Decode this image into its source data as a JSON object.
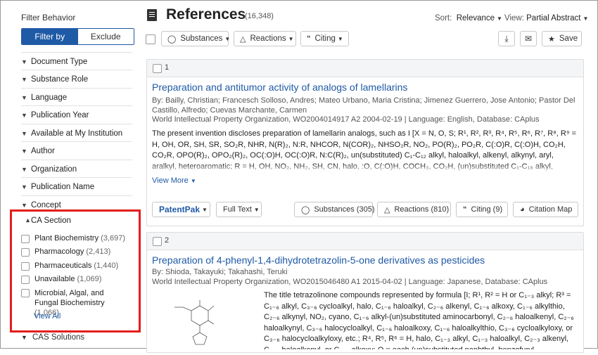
{
  "sidebar": {
    "title": "Filter Behavior",
    "filter_by": "Filter by",
    "exclude": "Exclude",
    "facets": [
      "Document Type",
      "Substance Role",
      "Language",
      "Publication Year",
      "Available at My Institution",
      "Author",
      "Organization",
      "Publication Name",
      "Concept"
    ],
    "cas_section": {
      "label": "CA Section",
      "options": [
        {
          "name": "Plant Biochemistry",
          "count": "(3,697)"
        },
        {
          "name": "Pharmacology",
          "count": "(2,413)"
        },
        {
          "name": "Pharmaceuticals",
          "count": "(1,440)"
        },
        {
          "name": "Unavailable",
          "count": "(1,069)"
        },
        {
          "name": "Microbial, Algal, and Fungal Biochemistry",
          "count": "(1,066)"
        }
      ],
      "view_all": "View All"
    },
    "cas_solutions": "CAS Solutions"
  },
  "header": {
    "title": "References",
    "count": "(16,348)",
    "sort_label": "Sort:",
    "sort_value": "Relevance",
    "view_label": "View:",
    "view_value": "Partial Abstract"
  },
  "toolbar": {
    "substances": "Substances",
    "reactions": "Reactions",
    "citing": "Citing",
    "save": "Save"
  },
  "results": [
    {
      "num": "1",
      "title": "Preparation and antitumor activity of analogs of lamellarins",
      "authors": "By: Bailly, Christian; Francesch Solloso, Andres; Mateo Urbano, Maria Cristina; Jimenez Guerrero, Jose Antonio; Pastor Del Castillo, Alfredo; Cuevas Marchante, Carmen",
      "source": "World Intellectual Property Organization, WO2004014917 A2 2004-02-19 | Language: English, Database: CAplus",
      "abstract": "The present invention discloses preparation of lamellarin analogs, such as I [X = N, O, S; R¹, R², R³, R⁴, R⁵, R⁶, R⁷, R⁸, R⁹ = H, OH, OR, SH, SR, SO₂R, NHR, N(R)₂, N:R, NHCOR, N(COR)₂, NHSO₂R, NO₂, PO(R)₂, PO₂R, C(:O)R, C(:O)H, CO₂H, CO₂R, OPO(R)₂, OPO₂(R)₂, OC(:O)H, OC(:O)R, N:C(R)₂, un(substituted) C₁-C₁₂ alkyl, haloalkyl, alkenyl, alkynyl, aryl, aralkyl, heteroaromatic; R = H, OH, NO₂, NH₂, SH, CN, halo, :O, C(:O)H, COCH₃, CO₂H, (un)substituted C₁-C₁₈ alkyl, alkenyl, alkynyl, aryl, alkoxyl, aminoalkyl, amino acid, thioalkyl, alkylsulfonyl, alkylsulfonyl, R¹R²R³R⁴R⁵R⁶R⁷R⁸R⁹R¹⁰",
      "view_more": "View More",
      "patentpak": "PatentPak",
      "full_text": "Full Text",
      "substances": "Substances (305)",
      "reactions": "Reactions (810)",
      "citing": "Citing (9)",
      "citation_map": "Citation Map"
    },
    {
      "num": "2",
      "title": "Preparation of 4-phenyl-1,4-dihydrotetrazolin-5-one derivatives as pesticides",
      "authors": "By: Shioda, Takayuki; Takahashi, Teruki",
      "source": "World Intellectual Property Organization, WO2015046480 A1 2015-04-02 | Language: Japanese, Database: CAplus",
      "abstract": "The title tetrazolinone compounds represented by formula [I; R¹, R² = H or C₁₋₃ alkyl; R³ = C₁₋₆ alkyl, C₃₋₆ cycloalkyl, halo, C₁₋₆ haloalkyl, C₂₋₆ alkenyl, C₁₋₆ alkoxy, C₁₋₆ alkylthio, C₂₋₆ alkynyl, NO₂, cyano, C₁₋₆ alkyl-(un)substituted aminocarbonyl, C₂₋₆ haloalkenyl, C₂₋₆ haloalkynyl, C₃₋₆ halocycloalkyl, C₁₋₆ haloalkoxy, C₁₋₆ haloalkylthio, C₃₋₆ cycloalkyloxy, or C₃₋₆ halocycloalkyloxy, etc.; R⁴, R⁵, R⁶ = H, halo, C₁₋₃ alkyl, C₁₋₃ haloalkyl, C₂₋₃ alkenyl, C₂₋₃ haloalkenyl, or C₁₋₃ alkoxy; Q = each (un)substituted naphthyl, benzofuryl, benzothiophenyl, indolyl, benzimidazolyl, indazolyl, ..."
    }
  ]
}
